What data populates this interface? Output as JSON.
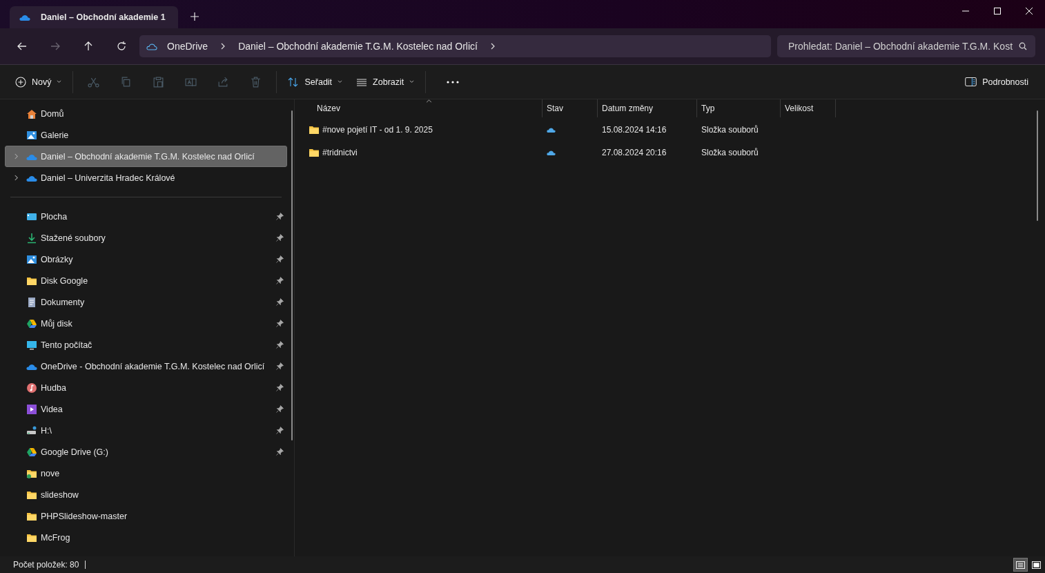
{
  "tab": {
    "title": "Daniel – Obchodní akademie 1",
    "kind": "cloud"
  },
  "nav": [
    {
      "kind": "back",
      "disabled": false
    },
    {
      "kind": "forward",
      "disabled": true
    },
    {
      "kind": "up",
      "disabled": false
    },
    {
      "kind": "refresh",
      "disabled": false
    }
  ],
  "address": {
    "segments": [
      "OneDrive",
      "Daniel – Obchodní akademie T.G.M. Kostelec nad Orlicí"
    ]
  },
  "search": {
    "placeholder": "Prohledat: Daniel – Obchodní akademie T.G.M. Kost"
  },
  "toolbar": {
    "new_label": "Nový",
    "actions": [
      {
        "kind": "cut",
        "disabled": true
      },
      {
        "kind": "copy",
        "disabled": true
      },
      {
        "kind": "paste",
        "disabled": true
      },
      {
        "kind": "rename",
        "disabled": true
      },
      {
        "kind": "share",
        "disabled": true
      },
      {
        "kind": "delete",
        "disabled": true
      }
    ],
    "sort_label": "Seřadit",
    "view_label": "Zobrazit",
    "details_label": "Podrobnosti"
  },
  "sidebar": {
    "top": [
      {
        "label": "Domů",
        "kind": "home",
        "expandable": false,
        "selected": false
      },
      {
        "label": "Galerie",
        "kind": "gallery",
        "expandable": false,
        "selected": false
      },
      {
        "label": "Daniel – Obchodní akademie T.G.M. Kostelec nad Orlicí",
        "kind": "cloud",
        "expandable": true,
        "selected": true
      },
      {
        "label": "Daniel – Univerzita Hradec Králové",
        "kind": "cloud",
        "expandable": true,
        "selected": false
      }
    ],
    "quick": [
      {
        "label": "Plocha",
        "kind": "desktop",
        "pinned": true
      },
      {
        "label": "Stažené soubory",
        "kind": "download",
        "pinned": true
      },
      {
        "label": "Obrázky",
        "kind": "gallery",
        "pinned": true
      },
      {
        "label": "Disk Google",
        "kind": "folder",
        "pinned": true
      },
      {
        "label": "Dokumenty",
        "kind": "document",
        "pinned": true
      },
      {
        "label": "Můj disk",
        "kind": "gdrive",
        "pinned": true
      },
      {
        "label": "Tento počítač",
        "kind": "pc",
        "pinned": true
      },
      {
        "label": "OneDrive - Obchodní akademie T.G.M. Kostelec nad Orlicí",
        "kind": "cloud",
        "pinned": true
      },
      {
        "label": "Hudba",
        "kind": "music",
        "pinned": true
      },
      {
        "label": "Videa",
        "kind": "video",
        "pinned": true
      },
      {
        "label": "H:\\",
        "kind": "drive",
        "pinned": true
      },
      {
        "label": "Google Drive (G:)",
        "kind": "gdrive",
        "pinned": true
      },
      {
        "label": "nove",
        "kind": "folder-sync",
        "pinned": false
      },
      {
        "label": "slideshow",
        "kind": "folder",
        "pinned": false
      },
      {
        "label": "PHPSlideshow-master",
        "kind": "folder",
        "pinned": false
      },
      {
        "label": "McFrog",
        "kind": "folder",
        "pinned": false
      }
    ]
  },
  "table": {
    "columns": [
      {
        "label": "Název",
        "sorted": true
      },
      {
        "label": "Stav",
        "sorted": false
      },
      {
        "label": "Datum změny",
        "sorted": false
      },
      {
        "label": "Typ",
        "sorted": false
      },
      {
        "label": "Velikost",
        "sorted": false
      }
    ],
    "rows": [
      {
        "name": "#nove pojetí IT - od 1. 9. 2025",
        "online_only": true,
        "modified": "15.08.2024 14:16",
        "type": "Složka souborů"
      },
      {
        "name": "#tridnictvi",
        "online_only": true,
        "modified": "27.08.2024 20:16",
        "type": "Složka souborů"
      }
    ]
  },
  "status_bar": {
    "count": "Počet položek: 80",
    "views": [
      {
        "kind": "details",
        "selected": true
      },
      {
        "kind": "tiles",
        "selected": false
      }
    ]
  }
}
